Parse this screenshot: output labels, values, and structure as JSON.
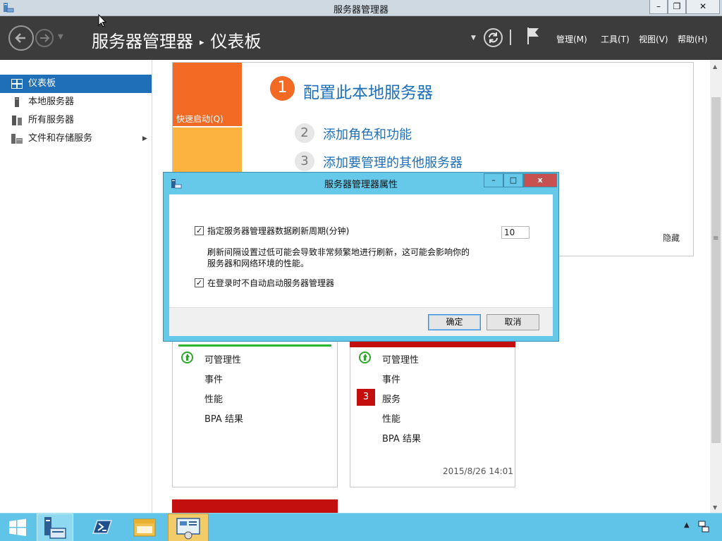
{
  "window": {
    "title": "服务器管理器",
    "min": "–",
    "max": "❐",
    "close": "✕"
  },
  "header": {
    "breadcrumb_root": "服务器管理器",
    "breadcrumb_sep": "▸",
    "breadcrumb_page": "仪表板",
    "menus": [
      "管理(M)",
      "工具(T)",
      "视图(V)",
      "帮助(H)"
    ]
  },
  "sidebar": {
    "items": [
      {
        "label": "仪表板",
        "icon": "dashboard-icon",
        "active": true
      },
      {
        "label": "本地服务器",
        "icon": "server-icon"
      },
      {
        "label": "所有服务器",
        "icon": "servers-icon"
      },
      {
        "label": "文件和存储服务",
        "icon": "storage-icon",
        "chevron": "▶"
      }
    ]
  },
  "quick_start": {
    "tile_label": "快速启动(Q)",
    "steps": [
      {
        "num": "1",
        "text": "配置此本地服务器"
      },
      {
        "num": "2",
        "text": "添加角色和功能"
      },
      {
        "num": "3",
        "text": "添加要管理的其他服务器"
      }
    ],
    "hide": "隐藏"
  },
  "cards": [
    {
      "rows": [
        "可管理性",
        "事件",
        "性能",
        "BPA 结果"
      ]
    },
    {
      "rows": [
        "可管理性",
        "事件",
        "服务",
        "性能",
        "BPA 结果"
      ],
      "badge": "3",
      "date": "2015/8/26 14:01"
    }
  ],
  "dialog": {
    "title": "服务器管理器属性",
    "refresh_label": "指定服务器管理器数据刷新周期(分钟)",
    "refresh_value": "10",
    "refresh_desc_line1": "刷新间隔设置过低可能会导致非常频繁地进行刷新，这可能会影响你的",
    "refresh_desc_line2": "服务器和网络环境的性能。",
    "autostart_label": "在登录时不自动启动服务器管理器",
    "refresh_checked": true,
    "autostart_checked": true,
    "ok": "确定",
    "cancel": "取消",
    "check_glyph": "✓",
    "btn_min": "–",
    "btn_max": "□",
    "btn_close": "x"
  },
  "scroll": {
    "up": "▲",
    "down": "▼",
    "grip": "≡"
  },
  "taskbar": {
    "tray_up": "▲"
  },
  "colors": {
    "accent": "#1e6fb8",
    "header_bg": "#3c3c3c",
    "quick_start_orange": "#f26a24",
    "alert_red": "#c40f0f",
    "ok_green": "#2db42d",
    "taskbar_blue": "#5fc4e8"
  }
}
